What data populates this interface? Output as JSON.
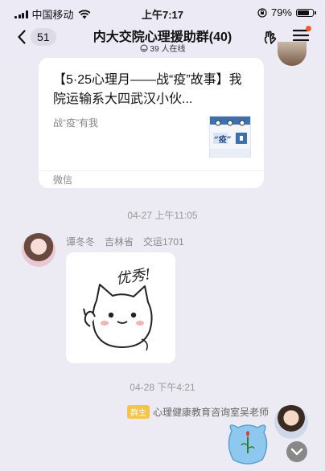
{
  "status_bar": {
    "carrier": "中国移动",
    "time": "上午7:17",
    "battery": "79%",
    "battery_level": 0.79
  },
  "nav": {
    "unread_count": "51",
    "title": "内大交院心理援助群(40)",
    "online": "39 人在线"
  },
  "card": {
    "title": "【5·25心理月——战“疫”故事】我院运输系大四武汉小伙...",
    "desc": "战“疫”有我",
    "source": "微信",
    "thumb_text": "“疫”"
  },
  "messages": {
    "time1": "04-27 上午11:05",
    "sender1": "谭冬冬　吉林省　交运1701",
    "sticker_text": "优秀!",
    "time2": "04-28 下午4:21",
    "sender2_badge": "群主",
    "sender2": "心理健康教育咨询室吴老师"
  },
  "colors": {
    "background": "#ecebf4",
    "accent_dot": "#ef5b2a",
    "owner_badge": "#f6c44a"
  }
}
